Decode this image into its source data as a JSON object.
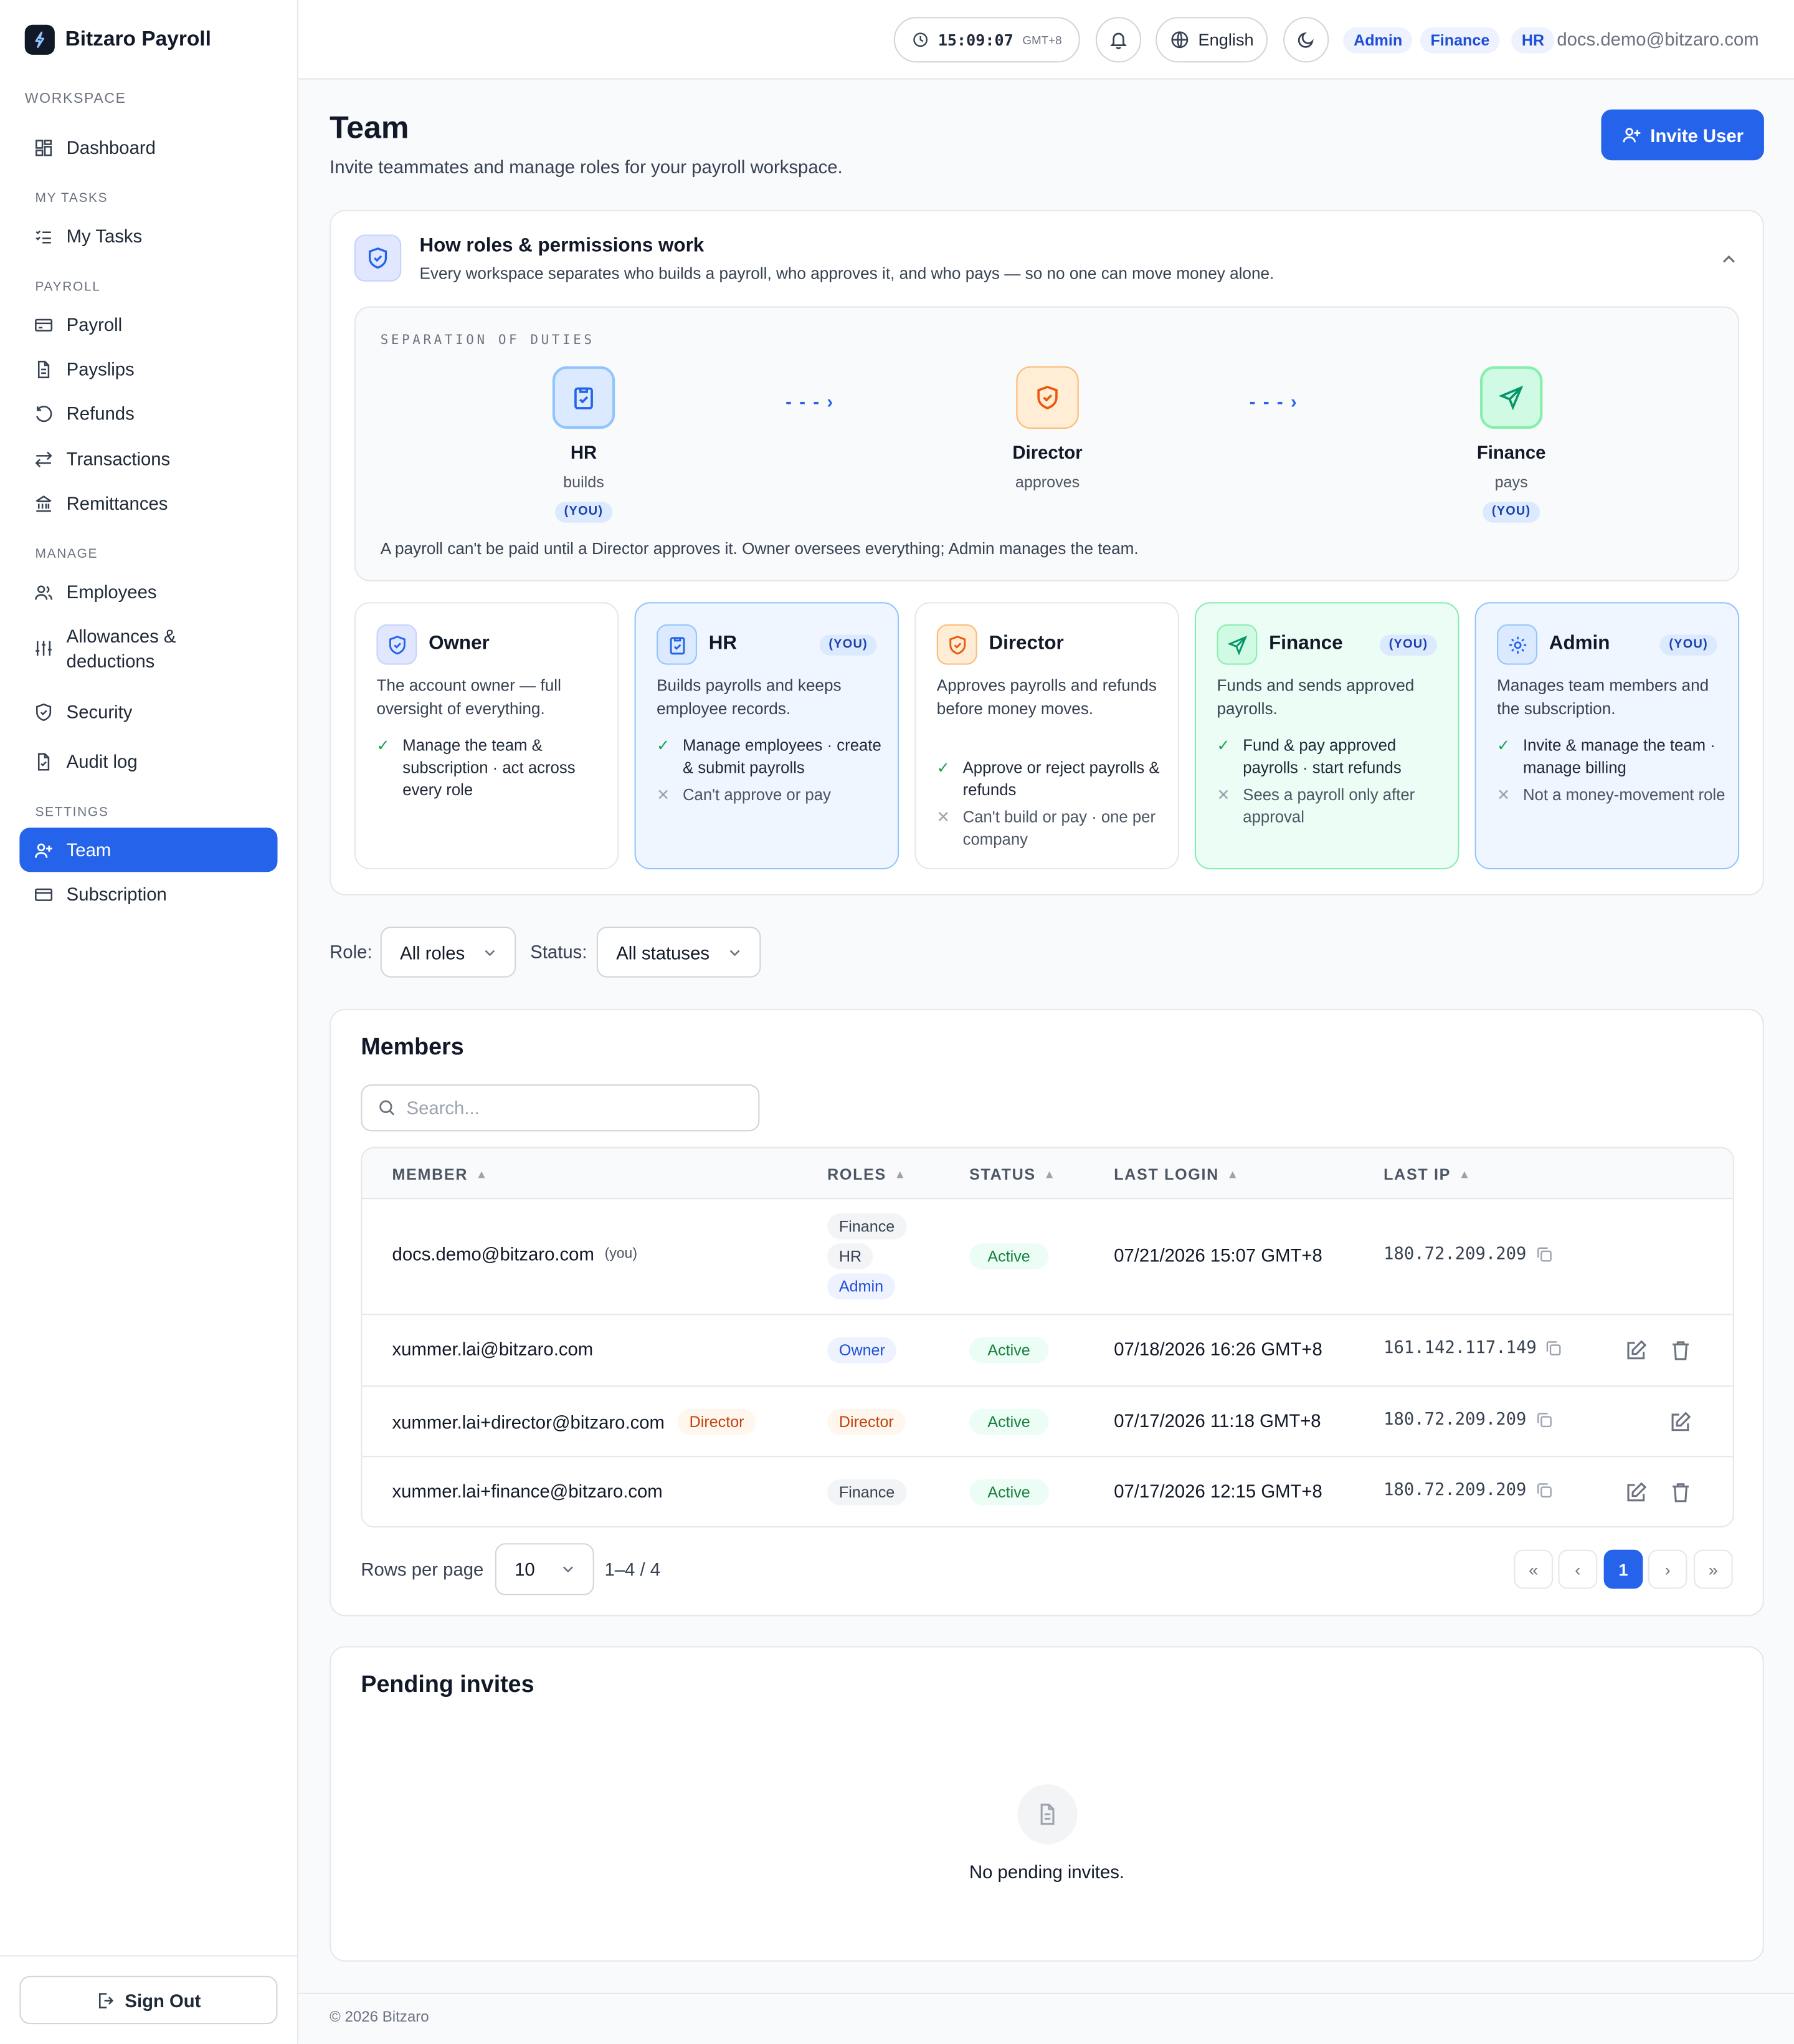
{
  "app": {
    "brand": "Bitzaro Payroll"
  },
  "sidebar": {
    "sections": {
      "workspace": "WORKSPACE",
      "my_tasks": "MY TASKS",
      "payroll": "PAYROLL",
      "manage": "MANAGE",
      "settings": "SETTINGS"
    },
    "items": {
      "dashboard": "Dashboard",
      "my_tasks": "My Tasks",
      "payroll": "Payroll",
      "payslips": "Payslips",
      "refunds": "Refunds",
      "transactions": "Transactions",
      "remittances": "Remittances",
      "employees": "Employees",
      "allowances_l1": "Allowances &",
      "allowances_l2": "deductions",
      "security": "Security",
      "audit_log": "Audit log",
      "team": "Team",
      "subscription": "Subscription"
    },
    "active": "team",
    "sign_out": "Sign Out"
  },
  "topbar": {
    "clock_time": "15:09:07",
    "clock_zone": "GMT+8",
    "language": "English",
    "roles": [
      "Admin",
      "Finance",
      "HR"
    ],
    "email": "docs.demo@bitzaro.com"
  },
  "header": {
    "title": "Team",
    "subtitle": "Invite teammates and manage roles for your payroll workspace.",
    "invite_button": "Invite User"
  },
  "roles_info": {
    "title": "How roles & permissions work",
    "subtitle": "Every workspace separates who builds a payroll, who approves it, and who pays — so no one can move money alone.",
    "duties_label": "SEPARATION OF DUTIES",
    "arrow": "- - - ›",
    "duties": [
      {
        "name": "HR",
        "verb": "builds",
        "you": "(YOU)"
      },
      {
        "name": "Director",
        "verb": "approves",
        "you": ""
      },
      {
        "name": "Finance",
        "verb": "pays",
        "you": "(YOU)"
      }
    ],
    "note": "A payroll can't be paid until a Director approves it. Owner oversees everything; Admin manages the team.",
    "cards": [
      {
        "name": "Owner",
        "you": "",
        "desc": "The account owner — full oversight of everything.",
        "yes": [
          "Manage the team & subscription · act across every role"
        ],
        "no": []
      },
      {
        "name": "HR",
        "you": "(YOU)",
        "desc": "Builds payrolls and keeps employee records.",
        "yes": [
          "Manage employees · create & submit payrolls"
        ],
        "no": [
          "Can't approve or pay"
        ]
      },
      {
        "name": "Director",
        "you": "",
        "desc": "Approves payrolls and refunds before money moves.",
        "yes": [
          "Approve or reject payrolls & refunds"
        ],
        "no": [
          "Can't build or pay · one per company"
        ]
      },
      {
        "name": "Finance",
        "you": "(YOU)",
        "desc": "Funds and sends approved payrolls.",
        "yes": [
          "Fund & pay approved payrolls · start refunds"
        ],
        "no": [
          "Sees a payroll only after approval"
        ]
      },
      {
        "name": "Admin",
        "you": "(YOU)",
        "desc": "Manages team members and the subscription.",
        "yes": [
          "Invite & manage the team · manage billing"
        ],
        "no": [
          "Not a money-movement role"
        ]
      }
    ]
  },
  "filters": {
    "role_label": "Role:",
    "role_value": "All roles",
    "status_label": "Status:",
    "status_value": "All statuses"
  },
  "members": {
    "title": "Members",
    "search_placeholder": "Search...",
    "columns": {
      "member": "MEMBER",
      "roles": "ROLES",
      "status": "STATUS",
      "last_login": "LAST LOGIN",
      "last_ip": "LAST IP"
    },
    "rows": [
      {
        "email": "docs.demo@bitzaro.com",
        "tag": "(you)",
        "roles": [
          "Finance",
          "HR",
          "Admin"
        ],
        "status": "Active",
        "last_login": "07/21/2026 15:07 GMT+8",
        "last_ip": "180.72.209.209"
      },
      {
        "email": "xummer.lai@bitzaro.com",
        "tag": "",
        "roles": [
          "Owner"
        ],
        "status": "Active",
        "last_login": "07/18/2026 16:26 GMT+8",
        "last_ip": "161.142.117.149"
      },
      {
        "email": "xummer.lai+director@bitzaro.com",
        "tag": "Director",
        "roles": [
          "Director"
        ],
        "status": "Active",
        "last_login": "07/17/2026 11:18 GMT+8",
        "last_ip": "180.72.209.209"
      },
      {
        "email": "xummer.lai+finance@bitzaro.com",
        "tag": "",
        "roles": [
          "Finance"
        ],
        "status": "Active",
        "last_login": "07/17/2026 12:15 GMT+8",
        "last_ip": "180.72.209.209"
      }
    ],
    "rows_per_page_label": "Rows per page",
    "rows_per_page": "10",
    "range": "1–4 / 4",
    "pager": {
      "first": "«",
      "prev": "‹",
      "current": "1",
      "next": "›",
      "last": "»"
    }
  },
  "pending": {
    "title": "Pending invites",
    "empty": "No pending invites."
  },
  "footer": "© 2026 Bitzaro",
  "colors": {
    "accent": "#2563eb",
    "success": "#16a34a",
    "director": "#c2410c"
  }
}
